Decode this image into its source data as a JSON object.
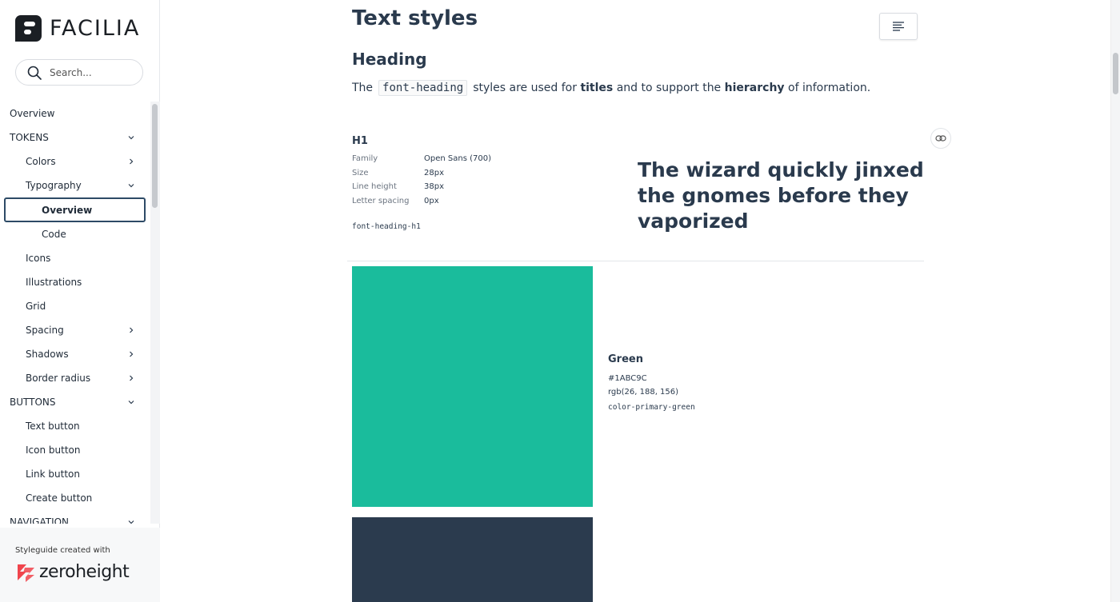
{
  "brand": {
    "name": "FACILIA"
  },
  "search": {
    "placeholder": "Search..."
  },
  "nav": {
    "items": [
      {
        "label": "Overview"
      },
      {
        "label": "TOKENS"
      },
      {
        "label": "Colors"
      },
      {
        "label": "Typography"
      },
      {
        "label": "Overview"
      },
      {
        "label": "Code"
      },
      {
        "label": "Icons"
      },
      {
        "label": "Illustrations"
      },
      {
        "label": "Grid"
      },
      {
        "label": "Spacing"
      },
      {
        "label": "Shadows"
      },
      {
        "label": "Border radius"
      },
      {
        "label": "BUTTONS"
      },
      {
        "label": "Text button"
      },
      {
        "label": "Icon button"
      },
      {
        "label": "Link button"
      },
      {
        "label": "Create button"
      },
      {
        "label": "NAVIGATION"
      }
    ]
  },
  "footer": {
    "text": "Styleguide created with",
    "brand": "zeroheight"
  },
  "page": {
    "title": "Text styles",
    "section": "Heading",
    "intro": {
      "before": "The",
      "code": "font-heading",
      "middle1": "styles are used for",
      "bold1": "titles",
      "middle2": "and to support the",
      "bold2": "hierarchy",
      "after": "of information."
    }
  },
  "h1": {
    "label": "H1",
    "specs": [
      {
        "key": "Family",
        "value": "Open Sans (700)"
      },
      {
        "key": "Size",
        "value": "28px"
      },
      {
        "key": "Line height",
        "value": "38px"
      },
      {
        "key": "Letter spacing",
        "value": "0px"
      }
    ],
    "token": "font-heading-h1",
    "sample": "The wizard quickly jinxed the gnomes before they vaporized"
  },
  "color": {
    "name": "Green",
    "hex": "#1ABC9C",
    "rgb": "rgb(26, 188, 156)",
    "token": "color-primary-green",
    "next_swatch": "#2B3B4E"
  },
  "colors": {
    "text": "#2A3A4D",
    "active_border": "#2D4A66",
    "zeroheight_red": "#F0444C"
  }
}
